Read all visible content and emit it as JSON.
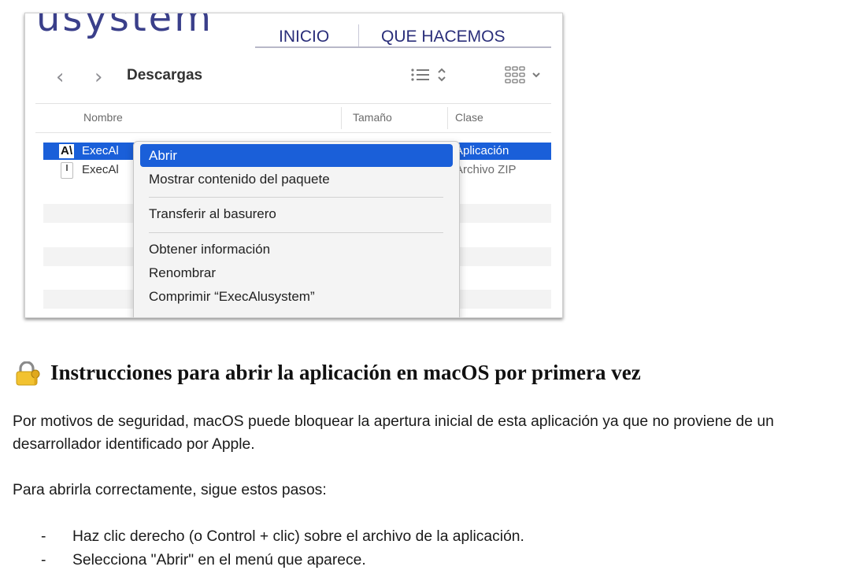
{
  "site": {
    "logo_text": "usystem",
    "nav": [
      "INICIO",
      "QUE HACEMOS"
    ]
  },
  "finder": {
    "folder_title": "Descargas",
    "columns": {
      "name": "Nombre",
      "size": "Tamaño",
      "kind": "Clase"
    },
    "rows": [
      {
        "name": "ExecAl",
        "kind": "Aplicación",
        "selected": true
      },
      {
        "name": "ExecAl",
        "kind": "Archivo ZIP",
        "selected": false
      }
    ],
    "app_icon_glyph": "A\\"
  },
  "context_menu": {
    "items": [
      "Abrir",
      "Mostrar contenido del paquete",
      "Transferir al basurero",
      "Obtener información",
      "Renombrar",
      "Comprimir “ExecAlusystem”"
    ]
  },
  "document": {
    "heading_icon": "lock-with-key-icon",
    "heading": "Instrucciones para abrir la aplicación en macOS por primera vez",
    "paragraph1": "Por motivos de seguridad, macOS puede bloquear la apertura inicial de esta aplicación ya que no proviene de un desarrollador identificado por Apple.",
    "paragraph2": "Para abrirla correctamente, sigue estos pasos:",
    "bullet_marker": "-",
    "steps": [
      "Haz clic derecho (o Control + clic) sobre el archivo de la aplicación.",
      "Selecciona \"Abrir\" en el menú que aparece."
    ]
  },
  "colors": {
    "selection_blue": "#1a5fd9",
    "site_navy": "#2a2e7a",
    "heading_icon_yellow": "#f2c230"
  }
}
